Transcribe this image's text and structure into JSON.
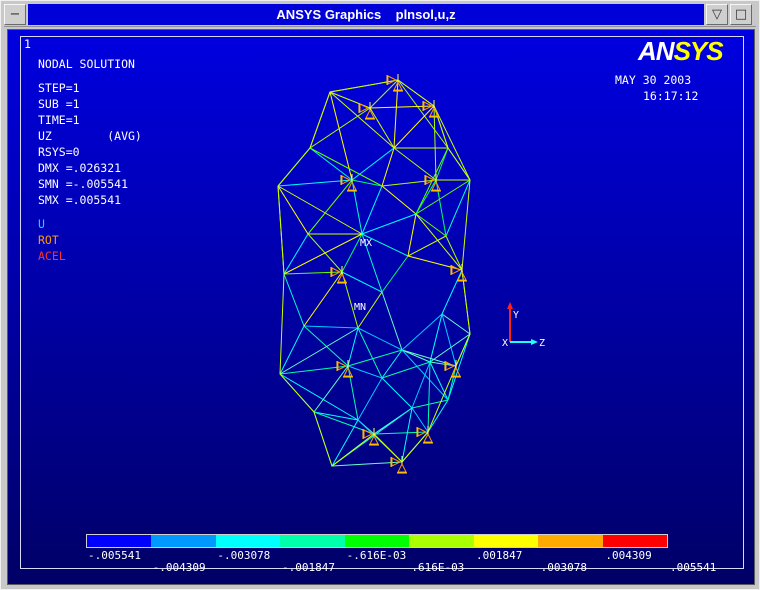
{
  "window": {
    "title": "ANSYS Graphics    plnsol,u,z",
    "controls": {
      "menu": "−",
      "minimize": "▽",
      "maximize": "□"
    }
  },
  "viewport": {
    "window_number": "1",
    "logo": {
      "an": "AN",
      "sys": "SYS"
    },
    "date": "MAY 30 2003",
    "time": "16:17:12",
    "solution_title": "NODAL SOLUTION",
    "info": [
      "STEP=1",
      "SUB =1",
      "TIME=1",
      "UZ        (AVG)",
      "RSYS=0",
      "DMX =.026321",
      "SMN =-.005541",
      "SMX =.005541"
    ],
    "symbols": [
      {
        "label": "U",
        "color": "#00e0ff"
      },
      {
        "label": "ROT",
        "color": "#ff9900"
      },
      {
        "label": "ACEL",
        "color": "#ff3030"
      }
    ],
    "markers": {
      "max": "MX",
      "min": "MN"
    },
    "triad": {
      "x": "X",
      "y": "Y",
      "z": "Z"
    }
  },
  "legend": {
    "colors": [
      "#0000ff",
      "#0099ff",
      "#00ffff",
      "#00ffaa",
      "#00ff00",
      "#aaff00",
      "#ffff00",
      "#ffaa00",
      "#ff0000"
    ],
    "top_labels": [
      "-.005541",
      "-.003078",
      "-.616E-03",
      ".001847",
      ".004309"
    ],
    "bottom_labels": [
      "-.004309",
      "-.001847",
      ".616E-03",
      ".003078",
      ".005541"
    ]
  }
}
